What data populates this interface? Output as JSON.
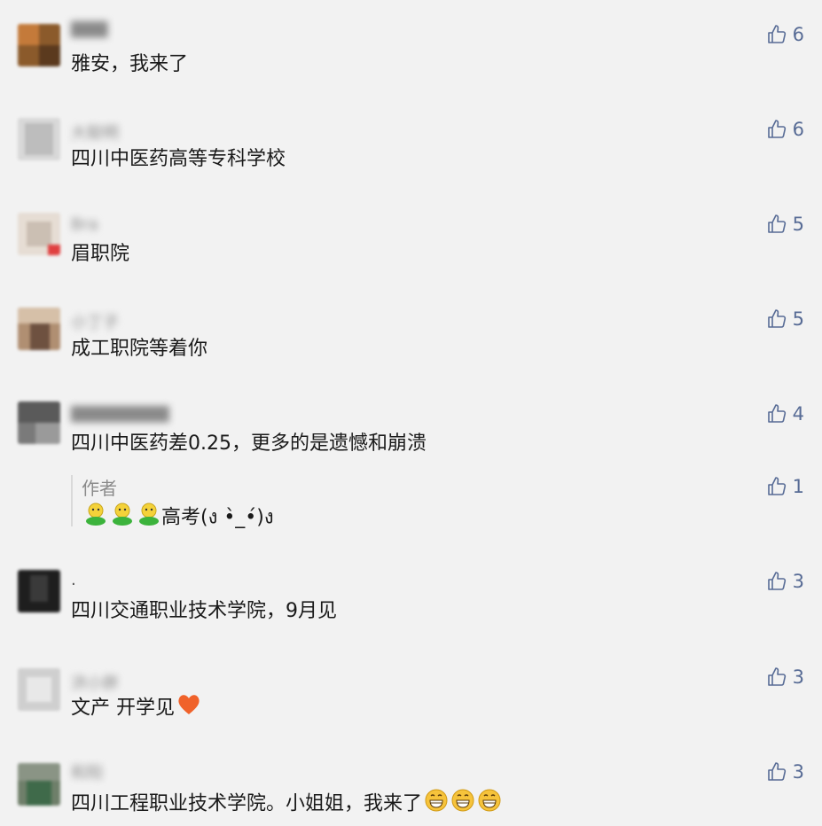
{
  "comments": [
    {
      "nick": "▇▇▇",
      "text": "雅安，我来了",
      "likes": "6"
    },
    {
      "nick": "大聪明",
      "text": "四川中医药高等专科学校",
      "likes": "6"
    },
    {
      "nick": "Bra",
      "text": "眉职院",
      "likes": "5"
    },
    {
      "nick": "小丁子",
      "text": "成工职院等着你",
      "likes": "5"
    },
    {
      "nick": "▇▇▇▇▇▇▇▇",
      "text": "四川中医药差0.25，更多的是遗憾和崩溃",
      "likes": "4",
      "reply": {
        "label": "作者",
        "text": "高考(ง •̀_•́)ง",
        "likes": "1"
      }
    },
    {
      "nick": ".",
      "text": "四川交通职业技术学院，9月见",
      "likes": "3"
    },
    {
      "nick": "洪小胖",
      "text": "文产 开学见",
      "likes": "3"
    },
    {
      "nick": "和阳",
      "text": "四川工程职业技术学院。小姐姐，我来了",
      "likes": "3"
    }
  ],
  "icons": {
    "like": "thumbs-up-icon",
    "heart": "heart-emoji-icon",
    "grin": "grin-emoji-icon",
    "sprout": "sprout-emoji-icon"
  },
  "colors": {
    "background": "#f2f2f2",
    "like": "#576b95",
    "meta": "#8a8a8a"
  }
}
